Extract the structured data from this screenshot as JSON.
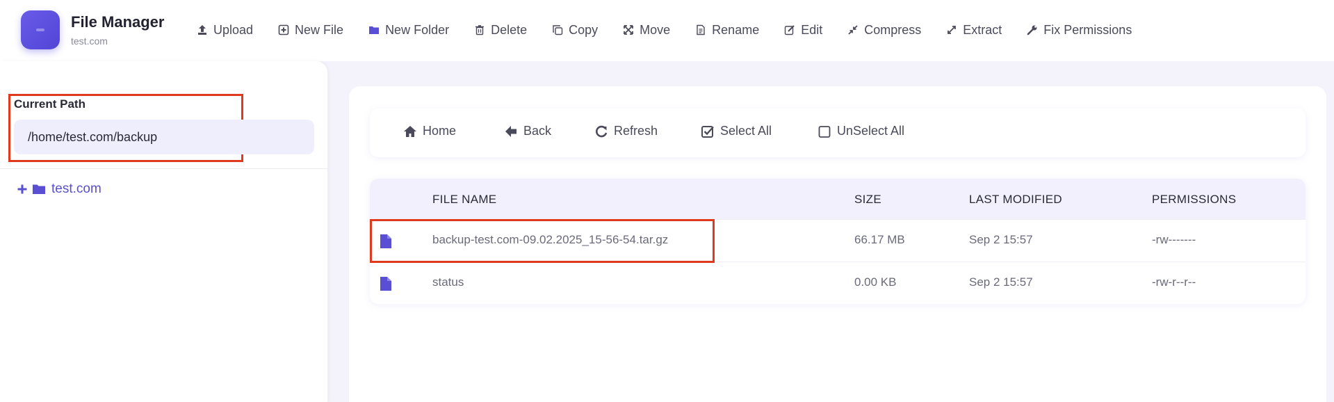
{
  "app": {
    "title": "File Manager",
    "subtitle": "test.com"
  },
  "toolbar": [
    {
      "label": "Upload",
      "icon": "upload-icon"
    },
    {
      "label": "New File",
      "icon": "new-file-icon"
    },
    {
      "label": "New Folder",
      "icon": "folder-icon"
    },
    {
      "label": "Delete",
      "icon": "trash-icon"
    },
    {
      "label": "Copy",
      "icon": "copy-icon"
    },
    {
      "label": "Move",
      "icon": "move-icon"
    },
    {
      "label": "Rename",
      "icon": "rename-icon"
    },
    {
      "label": "Edit",
      "icon": "edit-icon"
    },
    {
      "label": "Compress",
      "icon": "compress-icon"
    },
    {
      "label": "Extract",
      "icon": "extract-icon"
    },
    {
      "label": "Fix Permissions",
      "icon": "wrench-icon"
    }
  ],
  "sidebar": {
    "path_label": "Current Path",
    "path_value": "/home/test.com/backup",
    "tree": [
      {
        "label": "test.com"
      }
    ]
  },
  "nav": [
    {
      "label": "Home",
      "icon": "home-icon"
    },
    {
      "label": "Back",
      "icon": "back-arrow-icon"
    },
    {
      "label": "Refresh",
      "icon": "refresh-icon"
    },
    {
      "label": "Select All",
      "icon": "checked-box-icon"
    },
    {
      "label": "UnSelect All",
      "icon": "empty-box-icon"
    }
  ],
  "table": {
    "headers": [
      "FILE NAME",
      "SIZE",
      "LAST MODIFIED",
      "PERMISSIONS"
    ],
    "rows": [
      {
        "name": "backup-test.com-09.02.2025_15-56-54.tar.gz",
        "size": "66.17 MB",
        "modified": "Sep 2 15:57",
        "permissions": "-rw-------"
      },
      {
        "name": "status",
        "size": "0.00 KB",
        "modified": "Sep 2 15:57",
        "permissions": "-rw-r--r--"
      }
    ]
  },
  "colors": {
    "accent": "#5a4fd3",
    "highlight": "#e03a1e",
    "background": "#f4f3fb"
  }
}
